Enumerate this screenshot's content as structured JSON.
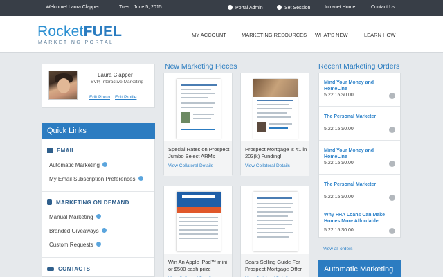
{
  "topbar": {
    "welcome": "Welcome! Laura Clapper",
    "date": "Tues., June 5, 2015",
    "portal_admin": "Portal Admin",
    "set_session": "Set Session",
    "intranet_home": "Intranet Home",
    "contact_us": "Contact Us"
  },
  "header": {
    "logo_light": "Rocket",
    "logo_bold": "FUEL",
    "logo_sub": "MARKETING PORTAL",
    "nav": [
      "MY ACCOUNT",
      "MARKETING RESOURCES",
      "WHAT'S NEW",
      "LEARN HOW"
    ]
  },
  "profile": {
    "name": "Laura Clapper",
    "title": "SVP, Interactive Marketing",
    "edit_photo": "Edit Photo",
    "edit_profile": "Edit Profile"
  },
  "quick_links": {
    "title": "Quick Links",
    "email": {
      "heading": "EMAIL",
      "items": [
        "Automatic Marketing",
        "My Email Subscription Preferences"
      ]
    },
    "mod": {
      "heading": "MARKETING ON DEMAND",
      "items": [
        "Manual Marketing",
        "Branded Giveaways",
        "Custom Requests"
      ]
    },
    "contacts": {
      "heading": "CONTACTS"
    }
  },
  "pieces": {
    "title": "New Marketing Pieces",
    "link_label": "View Collateral Details",
    "items": [
      {
        "caption": "Special Rates on Prospect Jumbo Select ARMs"
      },
      {
        "caption": "Prospect Mortgage is #1 in 203(k) Funding!"
      },
      {
        "caption": "Win An Apple iPad™ mini or $500 cash prize"
      },
      {
        "caption": "Sears Selling Guide For Prospect Mortgage Offer"
      }
    ]
  },
  "orders": {
    "title": "Recent Marketing Orders",
    "items": [
      {
        "title": "Mind Your Money and HomeLine",
        "meta": "5.22.15 $0.00"
      },
      {
        "title": "The Personal Marketer",
        "meta": "5.22.15 $0.00"
      },
      {
        "title": "Mind Your Money and HomeLine",
        "meta": "5.22.15 $0.00"
      },
      {
        "title": "The Personal Marketer",
        "meta": "5.22.15 $0.00"
      },
      {
        "title": "Why FHA Loans Can Make Homes More Affordable",
        "meta": "5.22.15 $0.00"
      }
    ],
    "view_all": "View all orders"
  },
  "automatic_marketing": {
    "title": "Automatic Marketing"
  }
}
